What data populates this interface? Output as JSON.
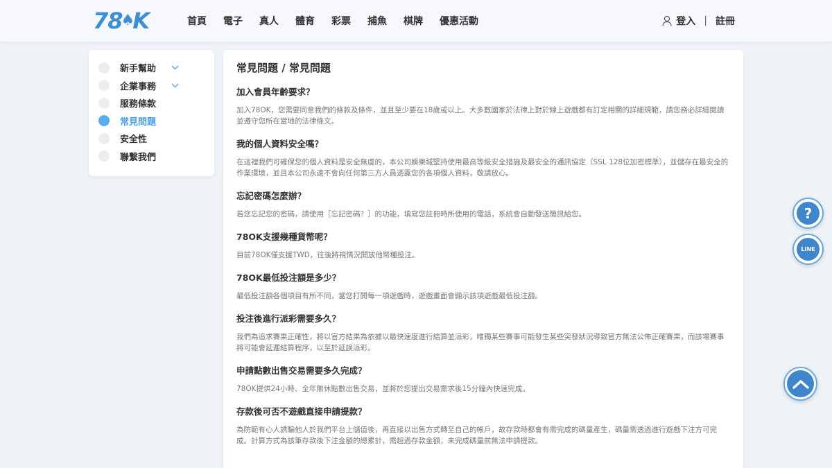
{
  "header": {
    "logo_text_left": "78",
    "logo_text_right": "K",
    "nav": [
      "首頁",
      "電子",
      "真人",
      "體育",
      "彩票",
      "捕魚",
      "棋牌",
      "優惠活動"
    ],
    "login": "登入",
    "separator": "|",
    "register": "註冊"
  },
  "sidebar": {
    "items": [
      {
        "label": "新手幫助",
        "expandable": true,
        "active": false
      },
      {
        "label": "企業事務",
        "expandable": true,
        "active": false
      },
      {
        "label": "服務條款",
        "expandable": false,
        "active": false
      },
      {
        "label": "常見問題",
        "expandable": false,
        "active": true
      },
      {
        "label": "安全性",
        "expandable": false,
        "active": false
      },
      {
        "label": "聯繫我們",
        "expandable": false,
        "active": false
      }
    ]
  },
  "main": {
    "title": "常見問題 / 常見問題",
    "faqs": [
      {
        "q": "加入會員年齡要求？",
        "a": "加入78OK，您需要同意我們的條款及條件，並且至少要在18歲或以上。大多數國家於法律上對於線上遊戲都有訂定相關的詳細規範，請您務必詳細閱讀並遵守您所在當地的法律條文。"
      },
      {
        "q": "我的個人資料安全嗎？",
        "a": "在這裡我們可確保您的個人資料是安全無虞的，本公司娛樂城堅持使用最高等級安全措施及最安全的通訊協定（SSL 128位加密標準），並儲存在最安全的作業環境，並且本公司永遠不會向任何第三方人員透露您的各項個人資料，敬請放心。"
      },
      {
        "q": "忘記密碼怎麼辦？",
        "a": "若您忘記您的密碼，請使用［忘記密碼？］的功能，填寫您註冊時所使用的電話，系統會自動發送簡訊給您。"
      },
      {
        "q": "78OK支援幾種貨幣呢？",
        "a": "目前78OK僅支援TWD，往後將視情況開放他幣種投注。"
      },
      {
        "q": "78OK最低投注額是多少？",
        "a": "最低投注額各個項目有所不同，當您打開每一項遊戲時，遊戲畫面會顯示該項遊戲最低投注額。"
      },
      {
        "q": "投注後進行派彩需要多久？",
        "a": "我們為追求賽果正確性，將以官方結果為依據以最快速度進行結算並派彩，唯獨某些賽事可能發生某些突發狀況導致官方無法公佈正確賽果，而該場賽事將可能會延遲結算程序，以至於延誤派彩。"
      },
      {
        "q": "申請點數出售交易需要多久完成？",
        "a": "78OK提供24小時、全年無休點數出售交易，並將於您提出交易需求後15分鐘內快速完成。"
      },
      {
        "q": "存款後可否不遊戲直接申請提款？",
        "a": "為防範有心人誘騙他人於我們平台上儲值後，再直接以出售方式轉至自己的帳戶，故存款時都會有需完成的碼量產生，碼量需透過進行遊戲下注方可完成。計算方式為該筆存款後下注金額的總累計，需超過存款金額，未完成碼量前無法申請提款。"
      }
    ]
  },
  "floating": {
    "help_symbol": "?",
    "line_label": "LINE"
  },
  "colors": {
    "accent": "#4a9ee8",
    "float_blue": "#3f86cc"
  }
}
